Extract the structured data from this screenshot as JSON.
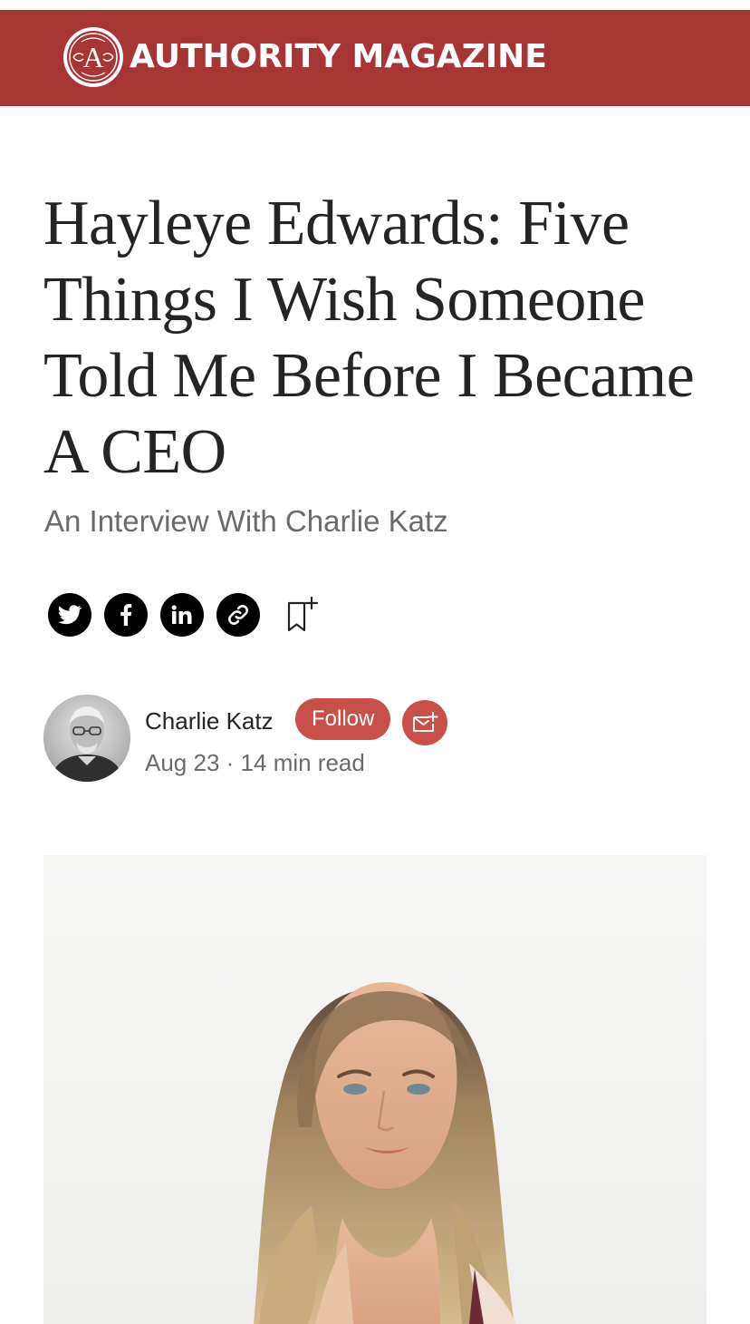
{
  "masthead": {
    "publication_name": "AUTHORITY MAGAZINE",
    "logo_letter": "A",
    "background_color": "#a63533"
  },
  "article": {
    "title": "Hayleye Edwards: Five Things I Wish Someone Told Me Before I Became A CEO",
    "subtitle": "An Interview With Charlie Katz"
  },
  "share": {
    "buttons": [
      {
        "icon": "twitter-icon"
      },
      {
        "icon": "facebook-icon"
      },
      {
        "icon": "linkedin-icon"
      },
      {
        "icon": "link-icon"
      }
    ],
    "bookmark_icon": "bookmark-add-icon"
  },
  "author": {
    "name": "Charlie Katz",
    "follow_label": "Follow",
    "subscribe_icon": "email-subscribe-icon",
    "date": "Aug 23",
    "separator": "·",
    "read_time": "14 min read",
    "accent_color": "#c94f4a"
  },
  "hero_image": {
    "description_icon": "portrait-photo"
  }
}
